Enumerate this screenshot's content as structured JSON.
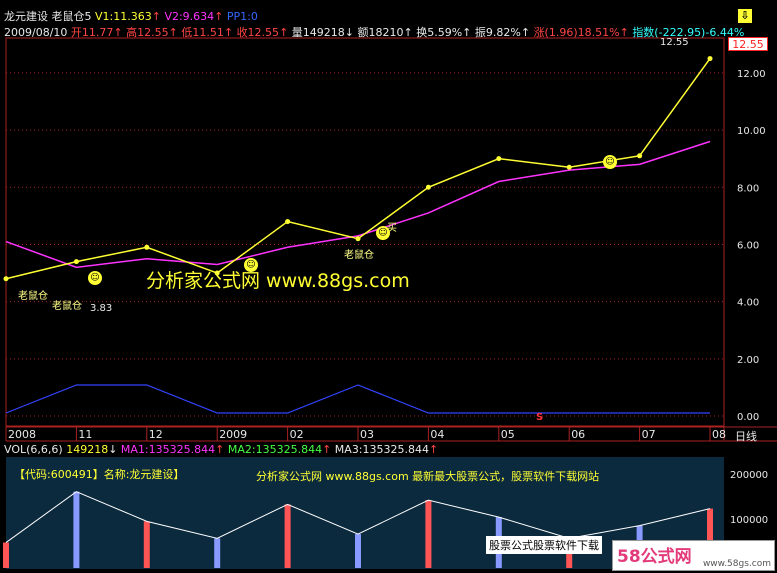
{
  "header": {
    "name": "龙元建设",
    "indicator": "老鼠仓5",
    "v1": "V1:11.363",
    "v2": "V2:9.634",
    "pp": "PP1:0",
    "date": "2009/08/10",
    "open": "开11.77",
    "high": "高12.55",
    "low": "低11.51",
    "close": "收12.55",
    "volume": "量149218",
    "amount": "额18210",
    "turnover": "换5.59%",
    "amplitude": "振9.82%",
    "change": "涨(1.96)18.51%",
    "index": "指数(-222.95)-6.44%"
  },
  "price_panel": {
    "price_tag": "12.55",
    "high_tag": "12.55",
    "low_tag": "3.83",
    "marks": [
      "老鼠仓",
      "老鼠仓",
      "老鼠仓",
      "买"
    ],
    "watermark": "分析家公式网 www.88gs.com",
    "s_mark": "S"
  },
  "x_axis": {
    "labels": [
      "2008",
      "11",
      "12",
      "2009",
      "02",
      "03",
      "04",
      "05",
      "06",
      "07",
      "08"
    ],
    "period": "日线"
  },
  "volume_header": {
    "name": "VOL(6,6,6)",
    "value": "149218",
    "ma1": "MA1:135325.844",
    "ma2": "MA2:135325.844",
    "ma3": "MA3:135325.844"
  },
  "volume_panel": {
    "code_label": "【代码:600491】名称:龙元建设】",
    "banner": "分析家公式网 www.88gs.com 最新最大股票公式，股票软件下载网站",
    "bottom_tag": "股票公式股票软件下载",
    "logo": "58公式网",
    "logo_url": "www.58gs.com",
    "y_ticks": [
      "200000",
      "100000"
    ]
  },
  "chart_data": {
    "type": "line",
    "ylim": [
      0,
      12.8
    ],
    "y_ticks": [
      0,
      2,
      4,
      6,
      8,
      10,
      12
    ],
    "y_tick_labels": [
      "0.00",
      "2.00",
      "4.00",
      "6.00",
      "8.00",
      "10.00",
      "12.00"
    ],
    "x": [
      "2008-10",
      "2008-11",
      "2008-12",
      "2009-01",
      "2009-02",
      "2009-03",
      "2009-04",
      "2009-05",
      "2009-06",
      "2009-07",
      "2009-08"
    ],
    "series": [
      {
        "values": [
          4.8,
          5.4,
          5.9,
          5.0,
          6.8,
          6.2,
          8.0,
          9.0,
          8.7,
          9.1,
          12.5
        ]
      },
      {
        "values": [
          6.1,
          5.2,
          5.5,
          5.3,
          5.9,
          6.3,
          7.1,
          8.2,
          8.6,
          8.8,
          9.6
        ]
      }
    ],
    "colors": {
      "price": "#ffff33",
      "ma": "#ff33ff",
      "signal": "#3344ff",
      "vol_ma": "#ffffff",
      "vol_bar_up": "#ff5555",
      "vol_bar_down": "#8899ff"
    },
    "signal_values": [
      0,
      1,
      1,
      0,
      0,
      1,
      0,
      0,
      0,
      0,
      0
    ],
    "volume_ylim": [
      0,
      250000
    ],
    "volume_ma_values": [
      60000,
      180000,
      110000,
      70000,
      150000,
      80000,
      160000,
      120000,
      70000,
      100000,
      140000
    ]
  }
}
